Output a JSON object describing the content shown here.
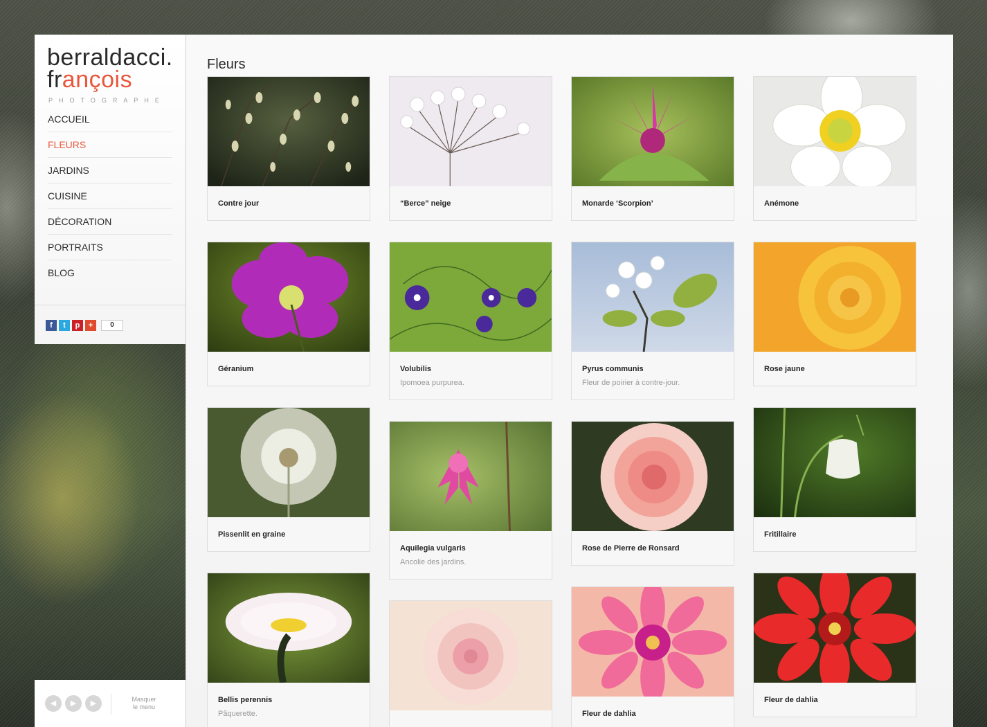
{
  "brand": {
    "line1": "berraldacci.",
    "line2_pre": "fr",
    "line2_accent": "ançois",
    "subtitle": "PHOTOGRAPHE",
    "accent_color": "#e8573c"
  },
  "nav": [
    {
      "label": "ACCUEIL",
      "active": false
    },
    {
      "label": "FLEURS",
      "active": true
    },
    {
      "label": "JARDINS",
      "active": false
    },
    {
      "label": "CUISINE",
      "active": false
    },
    {
      "label": "DÉCORATION",
      "active": false
    },
    {
      "label": "PORTRAITS",
      "active": false
    },
    {
      "label": "BLOG",
      "active": false
    }
  ],
  "share": {
    "icons": [
      "facebook-icon",
      "twitter-icon",
      "pinterest-icon",
      "plus-icon"
    ],
    "count": "0"
  },
  "controls": {
    "hide_menu_line1": "Masquer",
    "hide_menu_line2": "le menu"
  },
  "page": {
    "title": "Fleurs"
  },
  "gallery": [
    {
      "title": "Contre jour",
      "subtitle": ""
    },
    {
      "title": "“Berce” neige",
      "subtitle": ""
    },
    {
      "title": "Monarde ‘Scorpion’",
      "subtitle": ""
    },
    {
      "title": "Anémone",
      "subtitle": ""
    },
    {
      "title": "Géranium",
      "subtitle": ""
    },
    {
      "title": "Volubilis",
      "subtitle": "Ipomoea purpurea."
    },
    {
      "title": "Pyrus communis",
      "subtitle": "Fleur de poirier à contre-jour."
    },
    {
      "title": "Rose jaune",
      "subtitle": ""
    },
    {
      "title": "Pissenlit en graine",
      "subtitle": ""
    },
    {
      "title": "Aquilegia vulgaris",
      "subtitle": "Ancolie des jardins."
    },
    {
      "title": "Rose de Pierre de Ronsard",
      "subtitle": ""
    },
    {
      "title": "Fritillaire",
      "subtitle": ""
    },
    {
      "title": "Bellis perennis",
      "subtitle": "Pâquerette."
    },
    {
      "title": "",
      "subtitle": ""
    },
    {
      "title": "Fleur de dahlia",
      "subtitle": ""
    },
    {
      "title": "Fleur de dahlia",
      "subtitle": ""
    }
  ]
}
